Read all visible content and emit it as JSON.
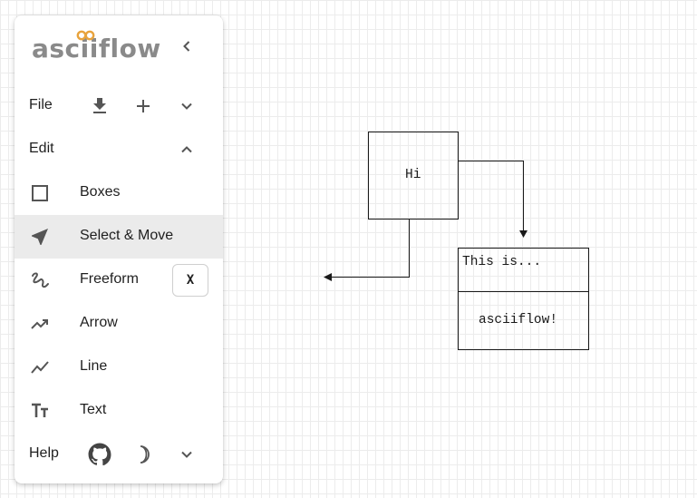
{
  "sidebar": {
    "logo": "asciiflow",
    "collapse_icon": "chevron-left-icon",
    "file": {
      "label": "File",
      "download_icon": "download-icon",
      "new_icon": "plus-icon",
      "expand_icon": "chevron-down-icon"
    },
    "edit": {
      "label": "Edit",
      "expand_icon": "chevron-up-icon"
    },
    "tools": [
      {
        "label": "Boxes",
        "icon": "box-icon",
        "selected": false
      },
      {
        "label": "Select & Move",
        "icon": "select-move-icon",
        "selected": true
      },
      {
        "label": "Freeform",
        "icon": "freeform-icon",
        "selected": false,
        "shortcut": "X"
      },
      {
        "label": "Arrow",
        "icon": "arrow-icon",
        "selected": false
      },
      {
        "label": "Line",
        "icon": "line-icon",
        "selected": false
      },
      {
        "label": "Text",
        "icon": "text-icon",
        "selected": false
      }
    ],
    "help": {
      "label": "Help",
      "github_icon": "github-icon",
      "theme_icon": "moon-icon",
      "expand_icon": "chevron-down-icon"
    }
  },
  "canvas": {
    "box1_text": "Hi",
    "box2_header": "This is...",
    "box2_body": "asciiflow!"
  },
  "colors": {
    "accent": "#e8a33d",
    "logo": "#8a8a8a",
    "selected_row": "#ebebeb",
    "grid": "#ececec"
  }
}
